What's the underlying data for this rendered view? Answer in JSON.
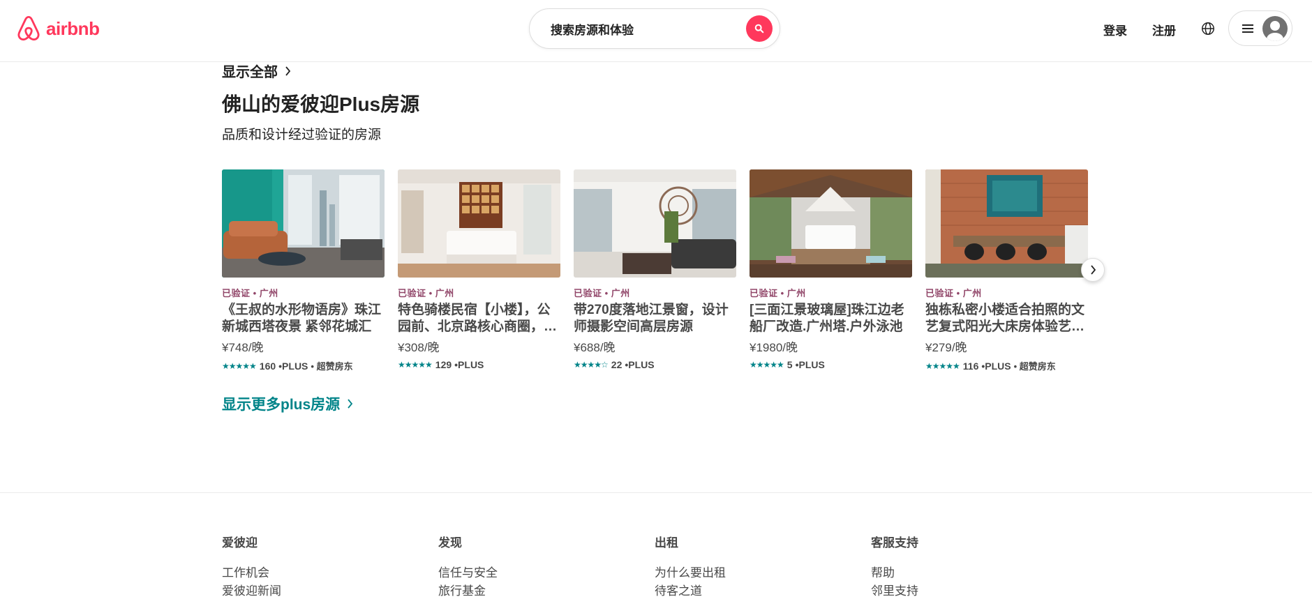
{
  "header": {
    "logo_text": "airbnb",
    "search_placeholder": "搜索房源和体验",
    "login_label": "登录",
    "signup_label": "注册",
    "brand_color": "#ff385c"
  },
  "section": {
    "show_all_label": "显示全部",
    "title": "佛山的爱彼迎Plus房源",
    "subtitle": "品质和设计经过验证的房源",
    "more_label": "显示更多plus房源"
  },
  "listings": [
    {
      "meta": "已验证 • 广州",
      "title": "《王叔的水形物语房》珠江新城西塔夜景 紧邻花城汇",
      "price": "¥748/晚",
      "stars": "★★★★★",
      "reviews": "160",
      "badge": "•PLUS",
      "host": "• 超赞房东"
    },
    {
      "meta": "已验证 • 广州",
      "title": "特色骑楼民宿【小楼】，公园前、北京路核心商圈，地铁",
      "price": "¥308/晚",
      "stars": "★★★★★",
      "reviews": "129",
      "badge": "•PLUS",
      "host": ""
    },
    {
      "meta": "已验证 • 广州",
      "title": "带270度落地江景窗，设计师摄影空间高层房源",
      "price": "¥688/晚",
      "stars": "★★★★☆",
      "reviews": "22",
      "badge": "•PLUS",
      "host": ""
    },
    {
      "meta": "已验证 • 广州",
      "title": "[三面江景玻璃屋]珠江边老船厂改造.广州塔.户外泳池",
      "price": "¥1980/晚",
      "stars": "★★★★★",
      "reviews": "5",
      "badge": "•PLUS",
      "host": ""
    },
    {
      "meta": "已验证 • 广州",
      "title": "独栋私密小楼适合拍照的文艺复式阳光大床房体验艺术区",
      "price": "¥279/晚",
      "stars": "★★★★★",
      "reviews": "116",
      "badge": "•PLUS",
      "host": "• 超赞房东"
    }
  ],
  "footer": {
    "columns": [
      {
        "heading": "爱彼迎",
        "links": [
          "工作机会",
          "爱彼迎新闻"
        ]
      },
      {
        "heading": "发现",
        "links": [
          "信任与安全",
          "旅行基金"
        ]
      },
      {
        "heading": "出租",
        "links": [
          "为什么要出租",
          "待客之道"
        ]
      },
      {
        "heading": "客服支持",
        "links": [
          "帮助",
          "邻里支持"
        ]
      }
    ]
  }
}
